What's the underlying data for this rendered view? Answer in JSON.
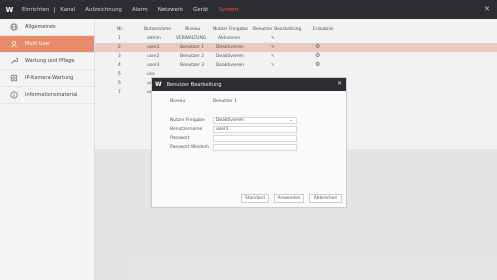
{
  "menu": {
    "items": [
      "Einrichten",
      "Kanal",
      "Aufzeichnung",
      "Alarm",
      "Netzwerk",
      "Gerät",
      "System"
    ],
    "active": "System"
  },
  "sidebar": {
    "items": [
      {
        "label": "Allgemeines",
        "icon": "globe-icon"
      },
      {
        "label": "Multi User",
        "icon": "users-icon"
      },
      {
        "label": "Wartung und Pflege",
        "icon": "wrench-icon"
      },
      {
        "label": "IP-Kamera-Wartung",
        "icon": "camera-icon"
      },
      {
        "label": "Informationsmaterial",
        "icon": "info-icon"
      }
    ],
    "active_index": 1
  },
  "table": {
    "headers": [
      "Nr.",
      "Nutzername",
      "Niveau",
      "Nutzer Freigabe",
      "Benutzer Bearbeitung",
      "Erlaubnis"
    ],
    "rows": [
      {
        "nr": "1",
        "name": "admin",
        "level": "VERWALTUNG",
        "release": "Aktivieren",
        "edit": true,
        "perm": false
      },
      {
        "nr": "2",
        "name": "user1",
        "level": "Benutzer 1",
        "release": "Deaktivieren",
        "edit": true,
        "perm": true
      },
      {
        "nr": "3",
        "name": "user2",
        "level": "Benutzer 2",
        "release": "Deaktivieren",
        "edit": true,
        "perm": true
      },
      {
        "nr": "4",
        "name": "user3",
        "level": "Benutzer 3",
        "release": "Deaktivieren",
        "edit": true,
        "perm": true
      },
      {
        "nr": "5",
        "name": "use",
        "level": "",
        "release": "",
        "edit": false,
        "perm": false
      },
      {
        "nr": "6",
        "name": "use",
        "level": "",
        "release": "",
        "edit": false,
        "perm": false
      },
      {
        "nr": "7",
        "name": "use",
        "level": "",
        "release": "",
        "edit": false,
        "perm": false
      }
    ],
    "selected_index": 1
  },
  "dialog": {
    "title": "Benutzer Bearbeitung",
    "niveau_label": "Niveau",
    "niveau_value": "Benutzer 1",
    "freigabe_label": "Nutzer Freigabe",
    "freigabe_value": "Deaktivieren",
    "username_label": "Benutzername",
    "username_value": "user1",
    "password_label": "Passwort",
    "password_repeat_label": "Passwort Wiederh",
    "buttons": {
      "default": "Standard",
      "apply": "Anwenden",
      "cancel": "Abbrechen"
    }
  },
  "colors": {
    "accent": "#e15a3a",
    "selected_row": "#f6d5ca",
    "sidebar_active": "#e98a6a",
    "topbar": "#2b2d33"
  }
}
